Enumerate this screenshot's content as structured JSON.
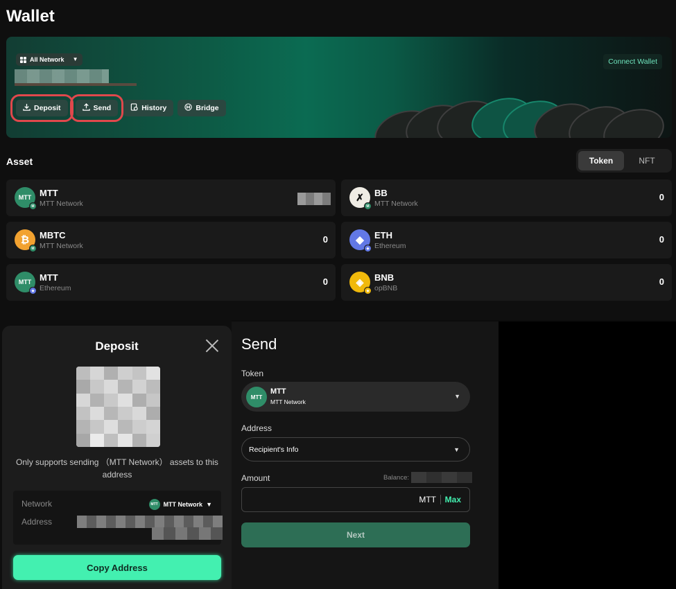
{
  "page": {
    "title": "Wallet"
  },
  "hero": {
    "network_select": "All Network",
    "connect_wallet": "Connect Wallet",
    "actions": [
      {
        "label": "Deposit",
        "icon": "download-icon"
      },
      {
        "label": "Send",
        "icon": "upload-icon"
      },
      {
        "label": "History",
        "icon": "history-icon"
      },
      {
        "label": "Bridge",
        "icon": "bridge-icon"
      }
    ]
  },
  "assets": {
    "title": "Asset",
    "tabs": [
      "Token",
      "NFT"
    ],
    "active_tab": "Token",
    "items": [
      {
        "name": "MTT",
        "network": "MTT Network",
        "amount": "",
        "icon_bg": "#2f8d68",
        "badge": "MTT"
      },
      {
        "name": "BB",
        "network": "MTT Network",
        "amount": "0",
        "icon_bg": "#efece4",
        "badge": "MTT"
      },
      {
        "name": "MBTC",
        "network": "MTT Network",
        "amount": "0",
        "icon_bg": "#f2a230",
        "badge": "MTT"
      },
      {
        "name": "ETH",
        "network": "Ethereum",
        "amount": "0",
        "icon_bg": "#6278e6",
        "badge": "ETH"
      },
      {
        "name": "MTT",
        "network": "Ethereum",
        "amount": "0",
        "icon_bg": "#2f8d68",
        "badge": "ETH"
      },
      {
        "name": "BNB",
        "network": "opBNB",
        "amount": "0",
        "icon_bg": "#f0b90b",
        "badge": "BNB"
      }
    ]
  },
  "deposit": {
    "title": "Deposit",
    "note": "Only supports sending （MTT Network） assets to this address",
    "network_label": "Network",
    "network_value": "MTT Network",
    "address_label": "Address",
    "copy_button": "Copy Address"
  },
  "send": {
    "title": "Send",
    "token_label": "Token",
    "token_name": "MTT",
    "token_network": "MTT Network",
    "address_label": "Address",
    "address_placeholder": "Recipient's Info",
    "amount_label": "Amount",
    "balance_label": "Balance:",
    "amount_unit": "MTT",
    "max_label": "Max",
    "next_button": "Next"
  },
  "colors": {
    "accent": "#43f0b0",
    "highlight": "#e0484c",
    "brand_green": "#2f8d68"
  }
}
